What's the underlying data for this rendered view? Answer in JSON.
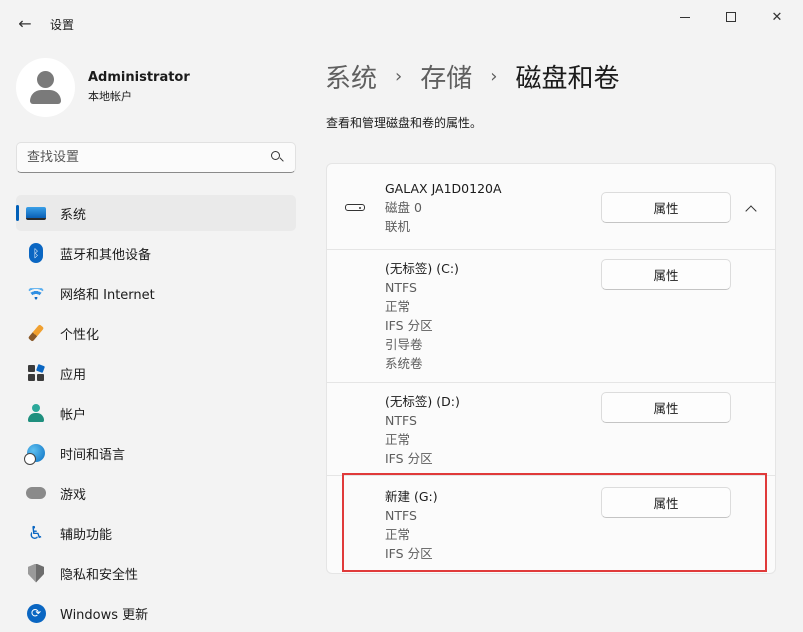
{
  "window": {
    "title": "设置",
    "back_icon": "back-arrow-icon",
    "controls": [
      "minimize-icon",
      "maximize-icon",
      "close-icon"
    ]
  },
  "profile": {
    "name": "Administrator",
    "account_type": "本地帐户"
  },
  "search": {
    "placeholder": "查找设置",
    "value": ""
  },
  "sidebar": {
    "items": [
      {
        "label": "系统",
        "icon": "monitor-icon",
        "active": true
      },
      {
        "label": "蓝牙和其他设备",
        "icon": "bluetooth-icon"
      },
      {
        "label": "网络和 Internet",
        "icon": "wifi-icon"
      },
      {
        "label": "个性化",
        "icon": "paintbrush-icon"
      },
      {
        "label": "应用",
        "icon": "apps-icon"
      },
      {
        "label": "帐户",
        "icon": "person-icon"
      },
      {
        "label": "时间和语言",
        "icon": "globe-clock-icon"
      },
      {
        "label": "游戏",
        "icon": "gamepad-icon"
      },
      {
        "label": "辅助功能",
        "icon": "accessibility-icon"
      },
      {
        "label": "隐私和安全性",
        "icon": "shield-icon"
      },
      {
        "label": "Windows 更新",
        "icon": "update-icon"
      }
    ]
  },
  "breadcrumb": {
    "items": [
      "系统",
      "存储",
      "磁盘和卷"
    ]
  },
  "page": {
    "description": "查看和管理磁盘和卷的属性。"
  },
  "disk": {
    "name": "GALAX JA1D0120A",
    "number": "磁盘 0",
    "status": "联机",
    "properties_label": "属性",
    "icon": "drive-icon",
    "collapse_icon": "chevron-up-icon"
  },
  "volumes": [
    {
      "label": "(无标签) (C:)",
      "details": [
        "NTFS",
        "正常",
        "IFS 分区",
        "引导卷",
        "系统卷"
      ],
      "properties_label": "属性"
    },
    {
      "label": "(无标签) (D:)",
      "details": [
        "NTFS",
        "正常",
        "IFS 分区"
      ],
      "properties_label": "属性"
    },
    {
      "label": "新建 (G:)",
      "details": [
        "NTFS",
        "正常",
        "IFS 分区"
      ],
      "properties_label": "属性"
    }
  ],
  "colors": {
    "accent": "#005fb8",
    "highlight_box": "#e03a3a"
  }
}
